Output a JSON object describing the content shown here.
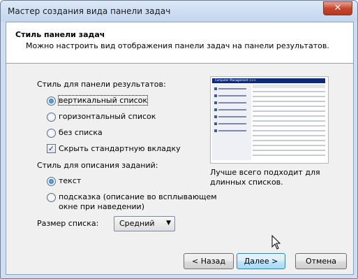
{
  "window": {
    "title": "Мастер создания вида панели задач",
    "close_glyph": "✕"
  },
  "header": {
    "title": "Стиль панели задач",
    "subtitle": "Можно настроить вид отображения панели задач на панели результатов."
  },
  "results_style": {
    "label": "Стиль для панели результатов:",
    "options": [
      {
        "label": "вертикальный список",
        "checked": true
      },
      {
        "label": "горизонтальный список",
        "checked": false
      },
      {
        "label": "без списка",
        "checked": false
      }
    ],
    "hide_tab": {
      "label": "Скрыть стандартную вкладку",
      "checked": true
    }
  },
  "description_style": {
    "label": "Стиль для описания заданий:",
    "options": [
      {
        "label": "текст",
        "checked": true
      },
      {
        "label_line1": "подсказка (описание во всплывающем",
        "label_line2": "окне при наведении)",
        "checked": false
      }
    ]
  },
  "list_size": {
    "label": "Размер списка:",
    "value": "Средний"
  },
  "preview": {
    "header_text": "Computer Management  >>>",
    "description_line1": "Лучше всего подходит для",
    "description_line2": "длинных списков."
  },
  "buttons": {
    "back": "< Назад",
    "next": "Далее >",
    "cancel": "Отмена"
  },
  "colors": {
    "title_bar": "#c2d6ee",
    "close_button": "#c8472c",
    "primary_button": "#bde6fd"
  }
}
